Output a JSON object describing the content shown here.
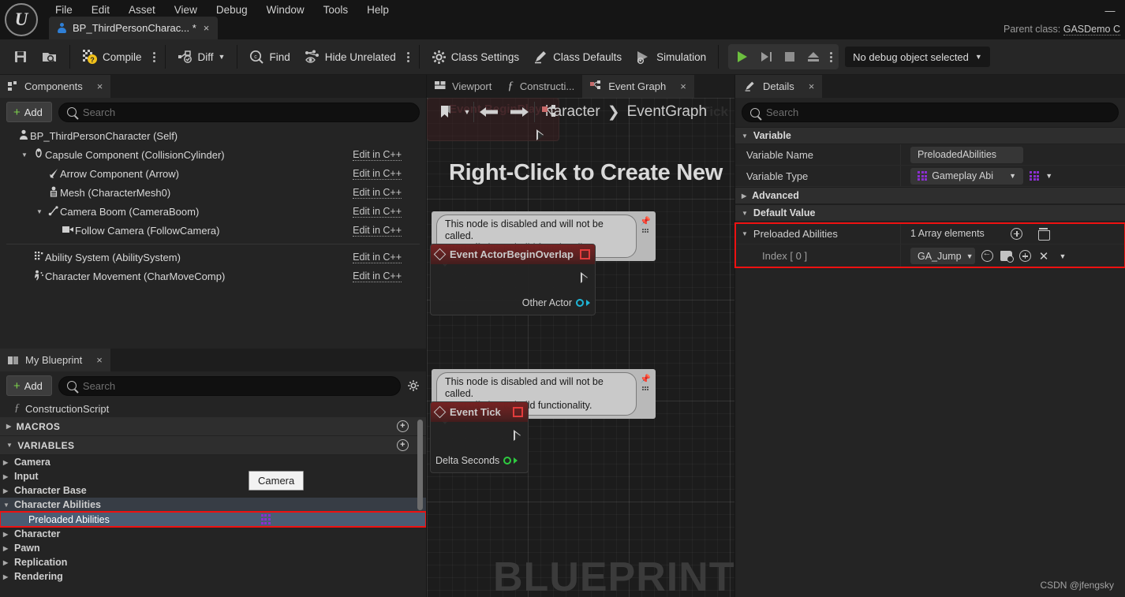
{
  "titlebar": {
    "logo_icon": "unreal-logo",
    "menu": [
      "File",
      "Edit",
      "Asset",
      "View",
      "Debug",
      "Window",
      "Tools",
      "Help"
    ],
    "window_controls": [
      "minimize"
    ],
    "minimize_glyph": "—",
    "tab": {
      "title": "BP_ThirdPersonCharac... *",
      "close": "×",
      "icon": "character-icon"
    },
    "parent_class_label": "Parent class:",
    "parent_class_value": "GASDemo C"
  },
  "toolbar": {
    "save_icon": "save-icon",
    "browse_icon": "browse-content-icon",
    "compile_label": "Compile",
    "diff_label": "Diff",
    "find_label": "Find",
    "hide_unrelated_label": "Hide Unrelated",
    "class_settings_label": "Class Settings",
    "class_defaults_label": "Class Defaults",
    "simulation_label": "Simulation",
    "play_label": "play",
    "step_label": "step",
    "stop_label": "stop",
    "eject_label": "eject",
    "debug_object": "No debug object selected",
    "accent_green": "#6cbf3f",
    "compile_badge": "?"
  },
  "components": {
    "tab_label": "Components",
    "tab_close": "×",
    "add_label": "Add",
    "search_placeholder": "Search",
    "edit_cpp_label": "Edit in C++",
    "tree": [
      {
        "label": "BP_ThirdPersonCharacter (Self)",
        "indent": 0,
        "arrow": "",
        "icon": "character-icon",
        "edit": false
      },
      {
        "label": "Capsule Component (CollisionCylinder)",
        "indent": 1,
        "arrow": "▼",
        "icon": "capsule-icon",
        "edit": true
      },
      {
        "label": "Arrow Component (Arrow)",
        "indent": 2,
        "arrow": "",
        "icon": "arrow-icon",
        "edit": true
      },
      {
        "label": "Mesh (CharacterMesh0)",
        "indent": 2,
        "arrow": "",
        "icon": "skeletal-mesh-icon",
        "edit": true
      },
      {
        "label": "Camera Boom (CameraBoom)",
        "indent": 2,
        "arrow": "▼",
        "icon": "spring-arm-icon",
        "edit": true
      },
      {
        "label": "Follow Camera (FollowCamera)",
        "indent": 3,
        "arrow": "",
        "icon": "camera-icon",
        "edit": true
      }
    ],
    "tree_below": [
      {
        "label": "Ability System (AbilitySystem)",
        "indent": 1,
        "arrow": "",
        "icon": "ability-system-icon",
        "edit": true
      },
      {
        "label": "Character Movement (CharMoveComp)",
        "indent": 1,
        "arrow": "",
        "icon": "movement-icon",
        "edit": true
      }
    ]
  },
  "myblueprint": {
    "tab_label": "My Blueprint",
    "tab_close": "×",
    "add_label": "Add",
    "search_placeholder": "Search",
    "settings_icon": "gear-icon",
    "construction_script": "ConstructionScript",
    "sections": [
      {
        "label": "MACROS",
        "arrow": "▶",
        "add": "+"
      },
      {
        "label": "VARIABLES",
        "arrow": "▼",
        "add": "+"
      }
    ],
    "variables": [
      {
        "label": "Camera",
        "arrow": "▶",
        "state": "normal"
      },
      {
        "label": "Input",
        "arrow": "▶",
        "state": "normal"
      },
      {
        "label": "Character Base",
        "arrow": "▶",
        "state": "normal"
      },
      {
        "label": "Character Abilities",
        "arrow": "▼",
        "state": "expanded"
      },
      {
        "label": "Preloaded Abilities",
        "arrow": "",
        "state": "selected",
        "array_icon": true
      },
      {
        "label": "Character",
        "arrow": "▶",
        "state": "normal"
      },
      {
        "label": "Pawn",
        "arrow": "▶",
        "state": "normal"
      },
      {
        "label": "Replication",
        "arrow": "▶",
        "state": "normal"
      },
      {
        "label": "Rendering",
        "arrow": "▶",
        "state": "normal"
      }
    ],
    "tooltip": "Camera",
    "highlight_color": "#ee1111"
  },
  "graph": {
    "tabs": [
      {
        "label": "Viewport",
        "icon": "viewport-icon",
        "active": false,
        "close": false
      },
      {
        "label": "Constructi...",
        "icon": "function-icon",
        "active": false,
        "close": false
      },
      {
        "label": "Event Graph",
        "icon": "event-graph-icon",
        "active": true,
        "close": true
      }
    ],
    "tab_close": "×",
    "toolbar": {
      "bookmark_icon": "bookmark-icon",
      "chevron_icon": "chevron-down-icon",
      "back_icon": "back-arrow-icon",
      "forward_icon": "forward-arrow-icon",
      "graph_icon": "event-graph-icon"
    },
    "breadcrumb": {
      "parent": "haracter",
      "separator": "❯",
      "current": "EventGraph"
    },
    "watermarks": {
      "create_new": "Right-Click to Create New",
      "blueprint": "BLUEPRINT",
      "begin_play": "Event BeginPlay",
      "tick_ghost": "Tick"
    },
    "nodes": [
      {
        "title": "Event ActorBeginOverlap",
        "bubble": [
          "This node is disabled and will not be called.",
          "Drag off pins to build functionality."
        ],
        "out_pin": "Other Actor",
        "out_pin_color": "#1fb5d6",
        "disabled": true
      },
      {
        "title": "Event Tick",
        "bubble": [
          "This node is disabled and will not be called.",
          "Drag off pins to build functionality."
        ],
        "out_pin": "Delta Seconds",
        "out_pin_color": "#2ecc40",
        "disabled": true
      }
    ]
  },
  "details": {
    "tab_label": "Details",
    "tab_close": "×",
    "search_placeholder": "Search",
    "sections": {
      "variable": "Variable",
      "advanced": "Advanced",
      "default_value": "Default Value"
    },
    "rows": {
      "variable_name_label": "Variable Name",
      "variable_name_value": "PreloadedAbilities",
      "variable_type_label": "Variable Type",
      "variable_type_value": "Gameplay Abi",
      "preloaded_abilities_label": "Preloaded Abilities",
      "array_elements": "1 Array elements",
      "index_label": "Index [ 0 ]",
      "index_value": "GA_Jump"
    },
    "icons": {
      "add_element": "circle-plus-icon",
      "delete_all": "trash-icon",
      "reset": "reset-arrow-icon",
      "browse": "browse-asset-icon",
      "insert": "circle-plus-icon",
      "clear": "clear-x-icon",
      "dropdown": "chevron-down-icon"
    },
    "highlight_color": "#ee1111"
  },
  "watermark": "CSDN @jfengsky"
}
